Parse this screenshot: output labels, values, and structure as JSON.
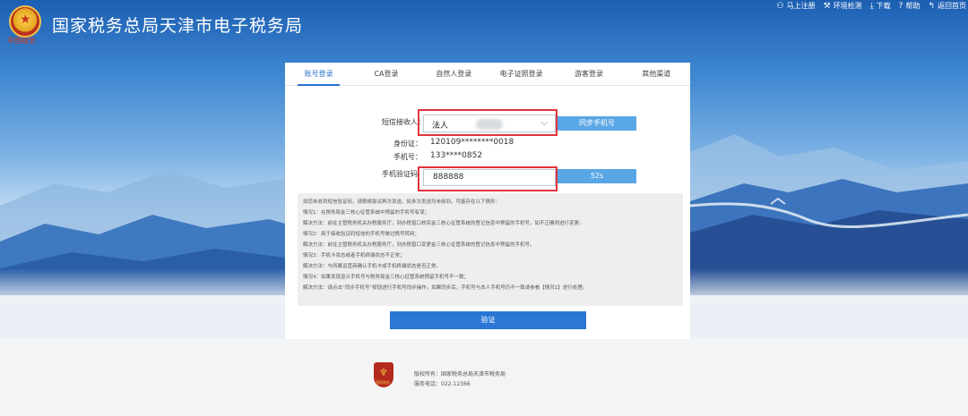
{
  "header": {
    "site_title": "国家税务总局天津市电子税务局",
    "emblem_caption": "中国税务",
    "links": [
      {
        "label": "马上注册",
        "icon": "user-icon"
      },
      {
        "label": "环境检测",
        "icon": "wrench-icon"
      },
      {
        "label": "下载",
        "icon": "download-icon"
      },
      {
        "label": "帮助",
        "icon": "help-icon"
      },
      {
        "label": "返回首页",
        "icon": "back-icon"
      }
    ]
  },
  "tabs": [
    "账号登录",
    "CA登录",
    "自然人登录",
    "电子证照登录",
    "游客登录",
    "其他渠道"
  ],
  "active_tab": "账号登录",
  "form": {
    "recipient_label": "短信接收人：",
    "recipient_value": "法人",
    "sync_button": "同步手机号",
    "id_label": "身份证：",
    "id_value": "120109********0018",
    "phone_label": "手机号：",
    "phone_value": "133****0852",
    "code_label": "手机验证码",
    "code_value": "888888",
    "countdown": "52s"
  },
  "notice_lines": [
    "如您未收到短信验证码，请稍候尝试再次发送。如多次发送均未收到，可能存在以下情形：",
    "情况1：在税务局金三核心征管系统中预留的手机号有误；",
    "解决方法：前往主管税务机关办税服务厅，到办税窗口核实金三核心征管系统的登记信息中预留的手机号，如不正确则进行变更。",
    "情况2：用于接收验证码短信的手机号做过携号转网；",
    "解决方法：前往主管税务机关办税服务厅，到办税窗口变更金三核心征管系统的登记信息中预留的手机号。",
    "情况3：手机卡状态或者手机终端状态不正常；",
    "解决方法：与所属运营商确认手机卡或手机终端状态是否正常。",
    "情况4：如果发现显示手机号与税务局金三核心征管系统预留手机号不一致；",
    "解决方法：请点击“同步手机号”按钮进行手机号同步操作。如果同步后，手机号与本人手机号仍不一致请参看【情况1】进行处理。"
  ],
  "verify_button": "验证",
  "footer": {
    "copyright": "版权所有：国家税务总局天津市税务局",
    "hotline": "服务电话：022-12366",
    "logo_caption": "国家税务"
  },
  "colors": {
    "primary": "#2a77d6",
    "tab_active": "#2a6fc9",
    "light_button": "#5aa7e6",
    "highlight_border": "#e0343b"
  }
}
